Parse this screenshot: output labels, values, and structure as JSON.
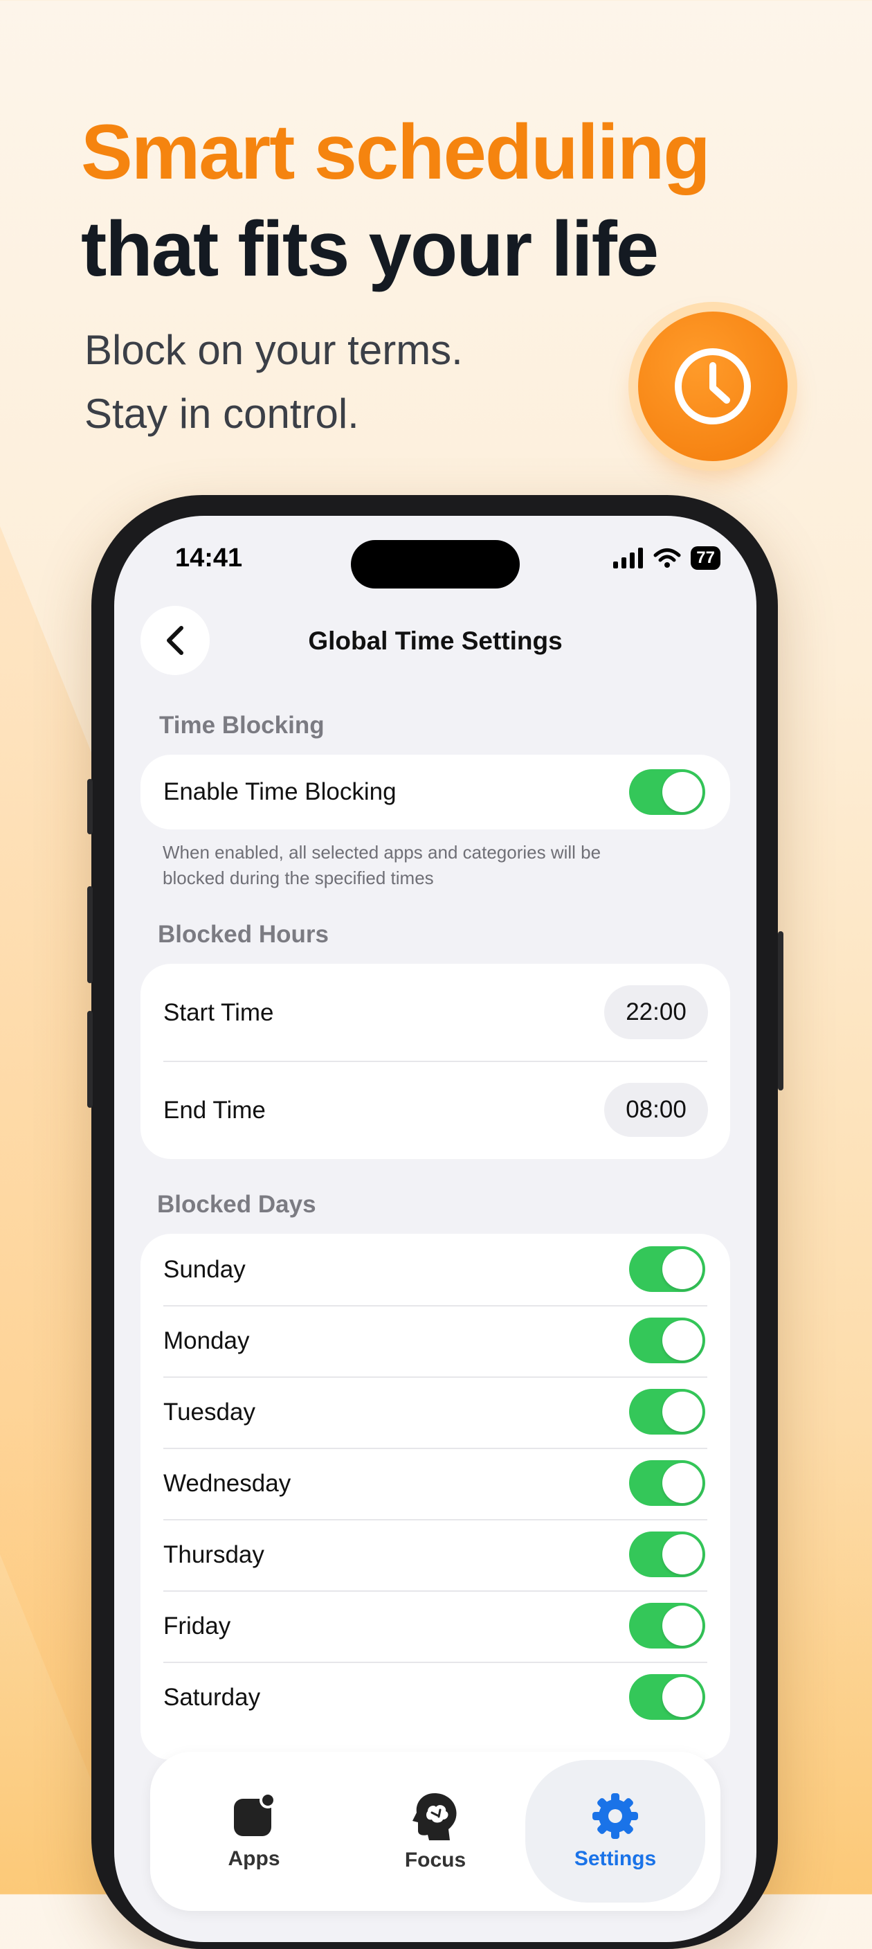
{
  "hero": {
    "headline_line1": "Smart scheduling",
    "headline_line2": "that fits your life",
    "sub_line1": "Block on your terms.",
    "sub_line2": "Stay in control.",
    "badge_icon": "clock-icon"
  },
  "status_bar": {
    "time": "14:41",
    "battery": "77"
  },
  "nav": {
    "title": "Global Time Settings",
    "back_icon": "chevron-left-icon"
  },
  "time_blocking": {
    "section": "Time Blocking",
    "toggle_label": "Enable Time Blocking",
    "enabled": true,
    "hint": "When enabled, all selected apps and categories will be blocked during the specified times"
  },
  "blocked_hours": {
    "section": "Blocked Hours",
    "start_label": "Start Time",
    "start_value": "22:00",
    "end_label": "End Time",
    "end_value": "08:00"
  },
  "blocked_days": {
    "section": "Blocked Days",
    "days": [
      {
        "label": "Sunday",
        "on": true
      },
      {
        "label": "Monday",
        "on": true
      },
      {
        "label": "Tuesday",
        "on": true
      },
      {
        "label": "Wednesday",
        "on": true
      },
      {
        "label": "Thursday",
        "on": true
      },
      {
        "label": "Friday",
        "on": true
      },
      {
        "label": "Saturday",
        "on": true
      }
    ]
  },
  "tabbar": {
    "tabs": [
      {
        "label": "Apps",
        "icon": "apps-icon"
      },
      {
        "label": "Focus",
        "icon": "brain-head-icon"
      },
      {
        "label": "Settings",
        "icon": "gear-icon",
        "active": true
      }
    ]
  },
  "colors": {
    "accent": "#f5840f",
    "toggle_on": "#34c759",
    "tab_active": "#1a73e8"
  }
}
